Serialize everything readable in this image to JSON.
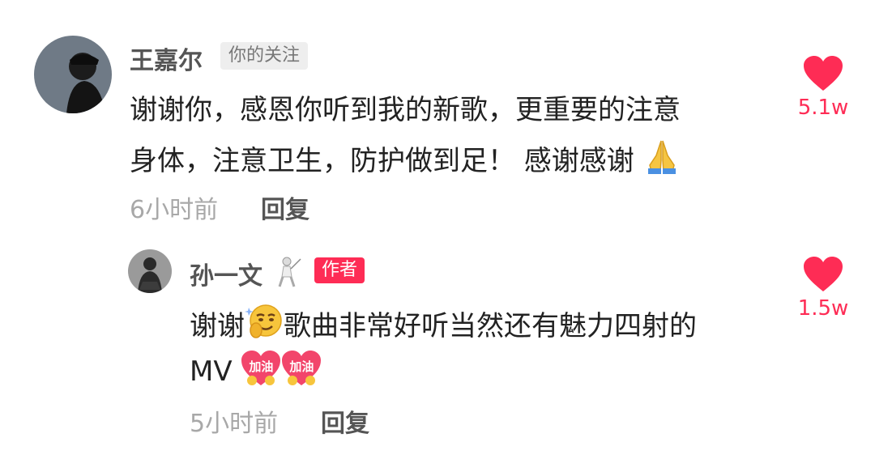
{
  "comment": {
    "author": "王嘉尔",
    "follow_tag": "你的关注",
    "text_line1": "谢谢你，感恩你听到我的新歌，更重要的注意",
    "text_line2": "身体，注意卫生，防护做到足！ 感谢感谢",
    "emoji": "folded-hands-icon",
    "time": "6小时前",
    "reply_label": "回复",
    "like_count": "5.1w"
  },
  "reply": {
    "author": "孙一文",
    "author_tag": "作者",
    "text_line1_a": "谢谢",
    "text_line1_b": "歌曲非常好听当然还有魅力四射的",
    "text_line2": "MV",
    "sticker_text": "加油",
    "time": "5小时前",
    "reply_label": "回复",
    "like_count": "1.5w"
  },
  "colors": {
    "accent": "#fe2c55",
    "muted": "#a8a8a8",
    "name": "#555555"
  }
}
